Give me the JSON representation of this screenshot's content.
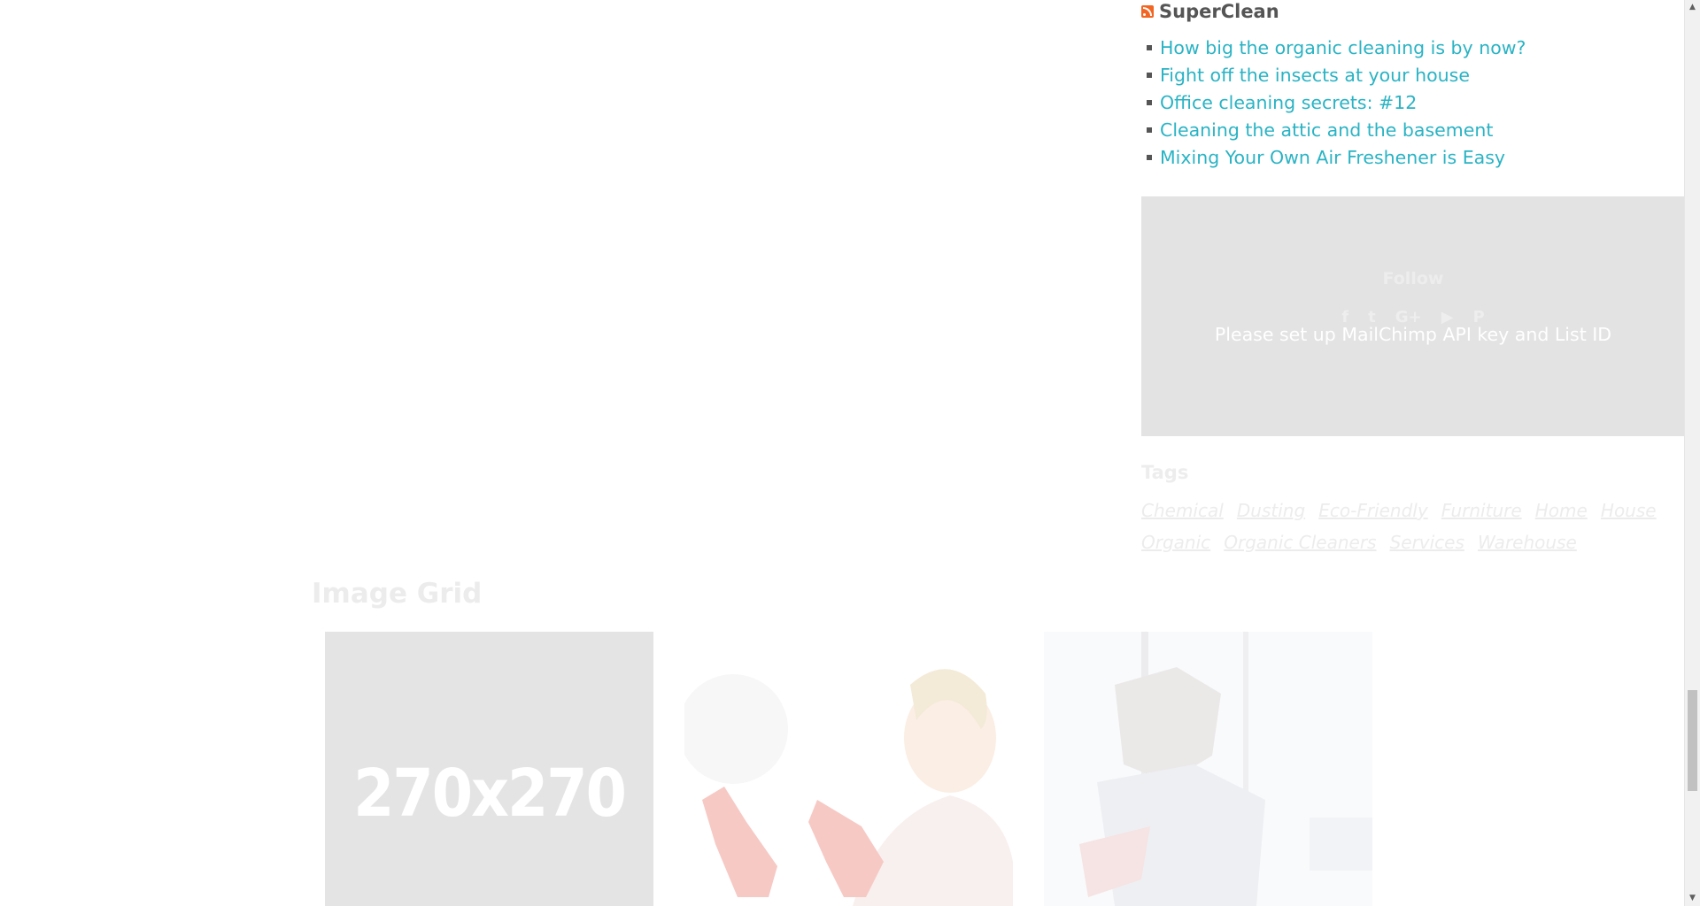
{
  "rss": {
    "title": "SuperClean",
    "items": [
      "How big the organic cleaning is by now?",
      "Fight off the insects at your house",
      "Office cleaning secrets: #12",
      "Cleaning the attic and the basement",
      "Mixing Your Own Air Freshener is Easy"
    ]
  },
  "follow": {
    "title": "Follow",
    "social": [
      {
        "icon": "facebook-icon",
        "glyph": "f"
      },
      {
        "icon": "twitter-icon",
        "glyph": "t"
      },
      {
        "icon": "google-plus-icon",
        "glyph": "G+"
      },
      {
        "icon": "youtube-icon",
        "glyph": "▶"
      },
      {
        "icon": "pinterest-icon",
        "glyph": "P"
      }
    ],
    "mailchimp_message": "Please set up MailChimp API key and List ID"
  },
  "tags": {
    "title": "Tags",
    "items": [
      "Chemical",
      "Dusting",
      "Eco-Friendly",
      "Furniture",
      "Home",
      "House",
      "Organic",
      "Organic Cleaners",
      "Services",
      "Warehouse"
    ]
  },
  "image_grid": {
    "title": "Image Grid",
    "placeholder_text": "270x270"
  },
  "colors": {
    "link": "#2ab3c4",
    "rss_icon": "#f26522",
    "panel_bg": "#e3e3e3"
  }
}
